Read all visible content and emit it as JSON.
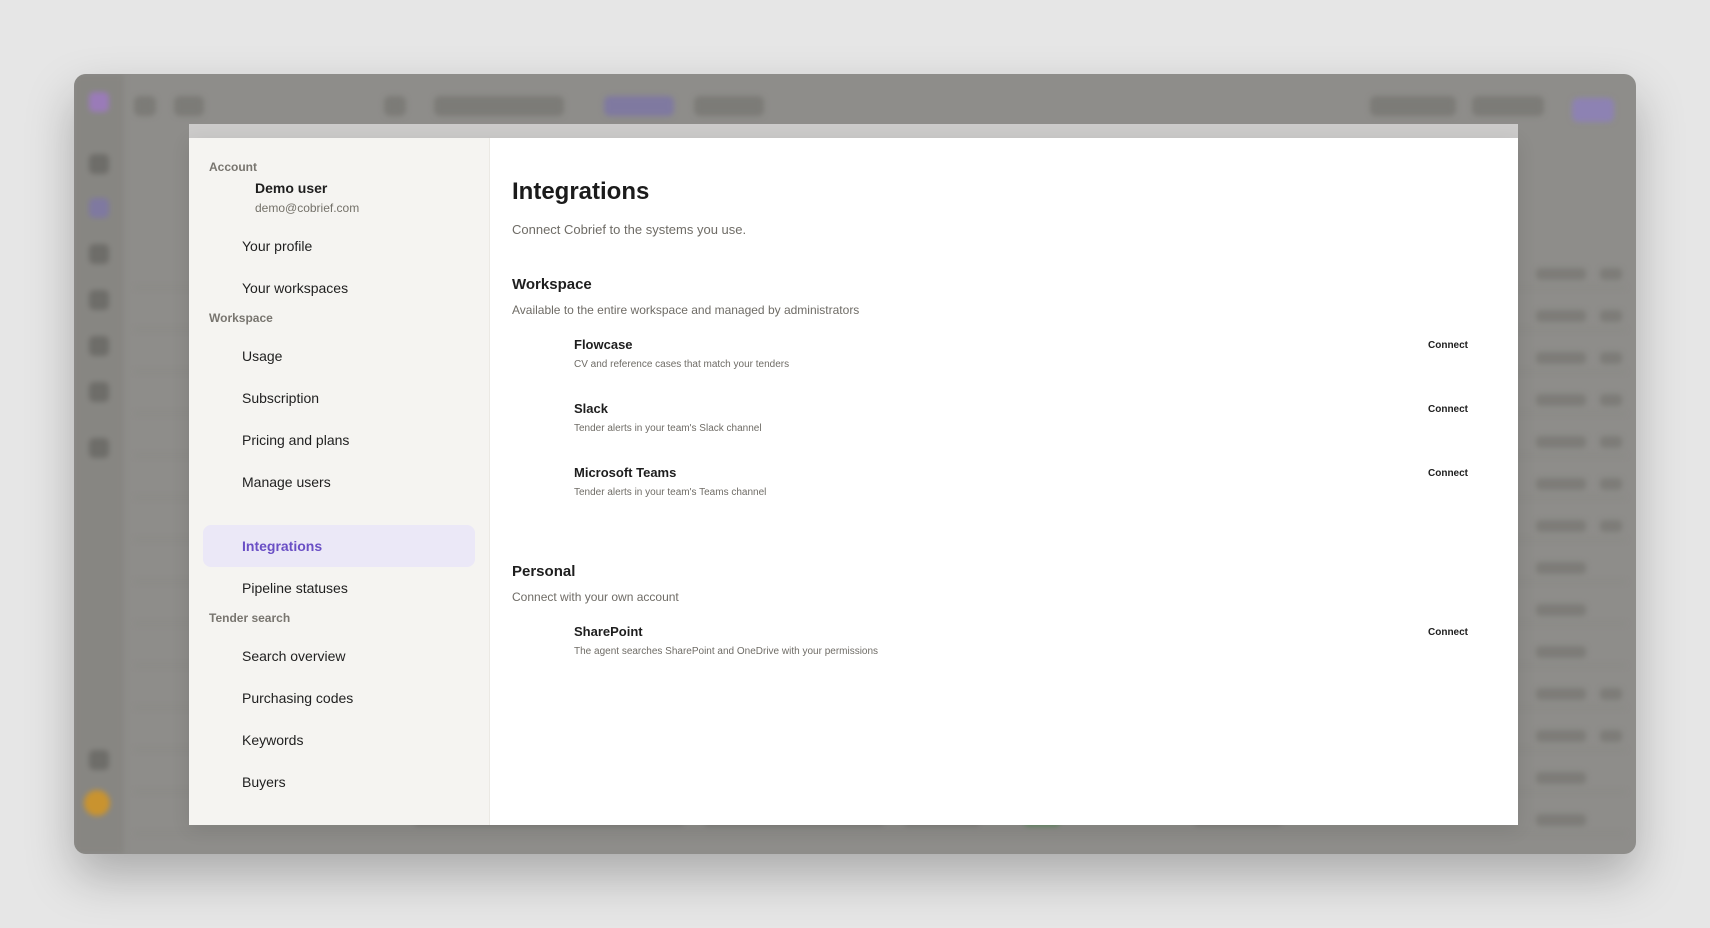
{
  "sidebar": {
    "account_title": "Account",
    "user": {
      "name": "Demo user",
      "email": "demo@cobrief.com"
    },
    "account_items": [
      "Your profile",
      "Your workspaces"
    ],
    "workspace_title": "Workspace",
    "workspace_items": [
      "Usage",
      "Subscription",
      "Pricing and plans",
      "Manage users",
      "Integrations",
      "Pipeline statuses"
    ],
    "active_item": "Integrations",
    "tender_title": "Tender search",
    "tender_items": [
      "Search overview",
      "Purchasing codes",
      "Keywords",
      "Buyers"
    ]
  },
  "main": {
    "title": "Integrations",
    "subtitle": "Connect Cobrief to the systems you use.",
    "workspace": {
      "title": "Workspace",
      "subtitle": "Available to the entire workspace and managed by administrators",
      "items": [
        {
          "name": "Flowcase",
          "description": "CV and reference cases that match your tenders",
          "action": "Connect"
        },
        {
          "name": "Slack",
          "description": "Tender alerts in your team's Slack channel",
          "action": "Connect"
        },
        {
          "name": "Microsoft Teams",
          "description": "Tender alerts in your team's Teams channel",
          "action": "Connect"
        }
      ]
    },
    "personal": {
      "title": "Personal",
      "subtitle": "Connect with your own account",
      "items": [
        {
          "name": "SharePoint",
          "description": "The agent searches SharePoint and OneDrive with your permissions",
          "action": "Connect"
        }
      ]
    }
  },
  "colors": {
    "accent": "#6a4fc5",
    "active_bg": "#ebe8f7",
    "sidebar_bg": "#f5f4f1"
  }
}
